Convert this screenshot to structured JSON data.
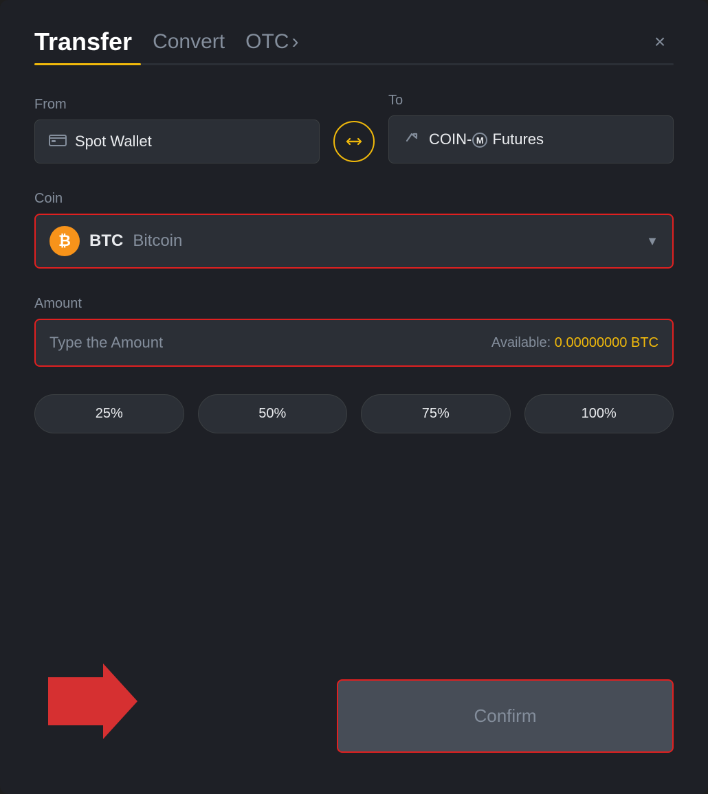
{
  "header": {
    "title": "Transfer",
    "tab_convert": "Convert",
    "tab_otc": "OTC",
    "tab_otc_chevron": "›",
    "close_label": "×"
  },
  "from_section": {
    "label": "From",
    "wallet_icon": "💳",
    "wallet_name": "Spot Wallet"
  },
  "swap": {
    "label": "swap-icon"
  },
  "to_section": {
    "label": "To",
    "wallet_icon": "↑",
    "wallet_name": "COIN-M Futures",
    "circle_m": "Ⓜ"
  },
  "coin_section": {
    "label": "Coin",
    "coin_symbol": "BTC",
    "coin_name": "Bitcoin",
    "btc_letter": "₿"
  },
  "amount_section": {
    "label": "Amount",
    "placeholder": "Type the Amount",
    "available_label": "Available:",
    "available_amount": "0.00000000 BTC"
  },
  "pct_buttons": [
    "25%",
    "50%",
    "75%",
    "100%"
  ],
  "confirm_button": {
    "label": "Confirm"
  },
  "colors": {
    "accent": "#f0b90b",
    "danger": "#e02020",
    "bg": "#1e2026",
    "surface": "#2b2f36",
    "text_primary": "#eaecef",
    "text_secondary": "#848e9c"
  }
}
